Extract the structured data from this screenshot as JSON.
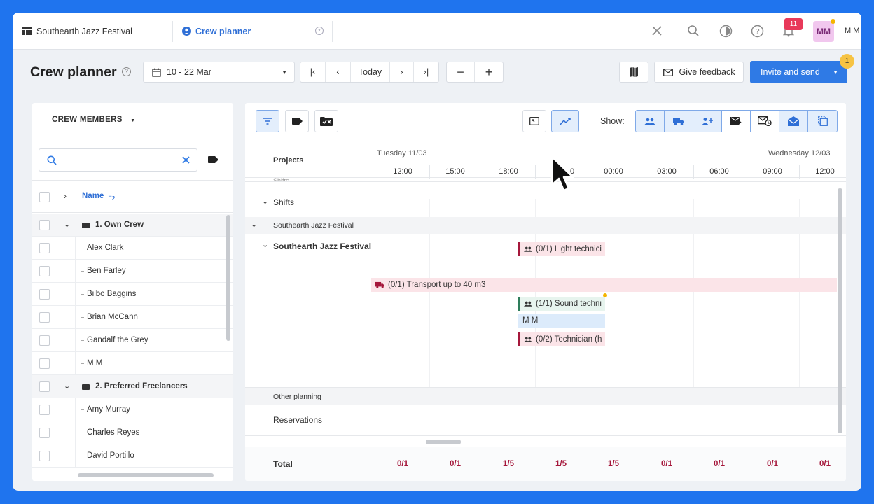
{
  "topbar": {
    "tab1_label": "Southearth Jazz Festival",
    "tab2_label": "Crew planner",
    "notification_count": "11",
    "avatar_initials": "MM",
    "user_name": "M M"
  },
  "toolbar": {
    "title": "Crew planner",
    "date_range": "10 - 22 Mar",
    "today_label": "Today",
    "give_feedback_label": "Give feedback",
    "invite_label": "Invite and send",
    "invite_badge": "1"
  },
  "left_panel": {
    "header": "CREW MEMBERS",
    "column_name": "Name",
    "sort_index": "2",
    "groups": [
      {
        "label": "1. Own Crew",
        "members": [
          "Alex Clark",
          "Ben Farley",
          "Bilbo Baggins",
          "Brian McCann",
          "Gandalf the Grey",
          "M M"
        ]
      },
      {
        "label": "2. Preferred Freelancers",
        "members": [
          "Amy Murray",
          "Charles Reyes",
          "David Portillo"
        ]
      }
    ]
  },
  "right_panel": {
    "show_label": "Show:",
    "projects_label": "Projects",
    "day1": "Tuesday 11/03",
    "day2": "Wednesday 12/03",
    "times": [
      "12:00",
      "15:00",
      "18:00",
      "0",
      "00:00",
      "03:00",
      "06:00",
      "09:00",
      "12:00"
    ],
    "cut_label": "Shifts",
    "shifts_label": "Shifts",
    "festival_group": "Southearth Jazz Festival",
    "festival_row": "Southearth Jazz Festival",
    "bars": {
      "light": "(0/1) Light technici",
      "transport": "(0/1) Transport up to 40 m3",
      "sound": "(1/1) Sound techni",
      "mm": "M M",
      "technician": "(0/2) Technician (h"
    },
    "other_planning": "Other planning",
    "reservations": "Reservations",
    "total_label": "Total",
    "totals": [
      "0/1",
      "0/1",
      "1/5",
      "1/5",
      "1/5",
      "0/1",
      "0/1",
      "0/1",
      "0/1"
    ]
  }
}
